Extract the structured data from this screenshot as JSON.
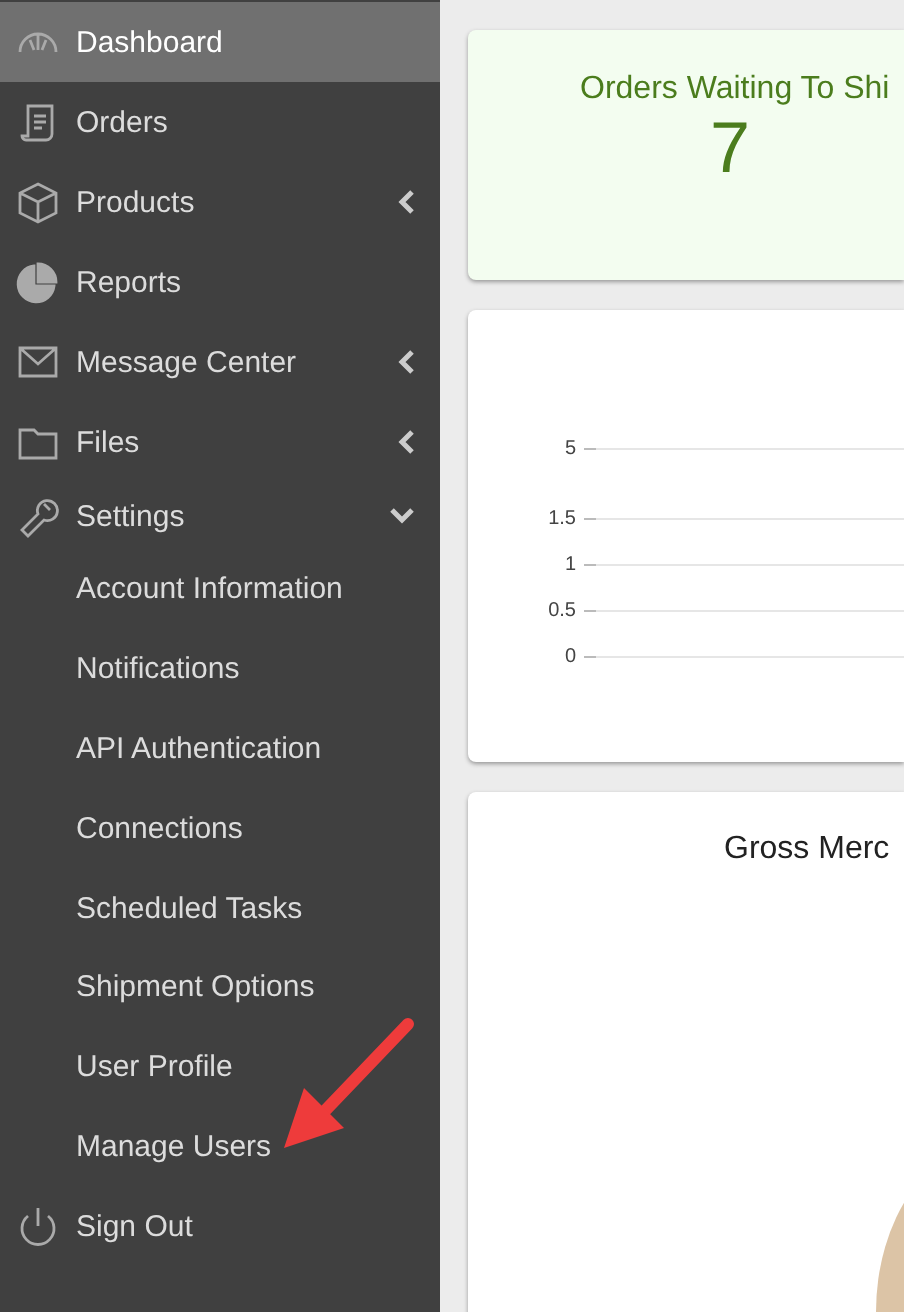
{
  "sidebar": {
    "items": [
      {
        "label": "Dashboard",
        "selected": true
      },
      {
        "label": "Orders",
        "selected": false
      },
      {
        "label": "Products",
        "selected": false,
        "expanded": false
      },
      {
        "label": "Reports",
        "selected": false
      },
      {
        "label": "Message Center",
        "selected": false,
        "expanded": false
      },
      {
        "label": "Files",
        "selected": false,
        "expanded": false
      },
      {
        "label": "Settings",
        "selected": false,
        "expanded": true,
        "children": [
          {
            "label": "Account Information",
            "selected": false
          },
          {
            "label": "Notifications",
            "selected": false
          },
          {
            "label": "API Authentication",
            "selected": false
          },
          {
            "label": "Connections",
            "selected": false
          },
          {
            "label": "Scheduled Tasks",
            "selected": false
          },
          {
            "label": "Shipment Options",
            "selected": false
          },
          {
            "label": "User Profile",
            "selected": false
          },
          {
            "label": "Manage Users",
            "selected": false
          }
        ]
      },
      {
        "label": "Sign Out",
        "selected": false
      }
    ]
  },
  "orders_card": {
    "title": "Orders Waiting To Shi",
    "value": "7"
  },
  "chart_card": {
    "y_ticks": [
      "5",
      "1.5",
      "1",
      "0.5",
      "0"
    ]
  },
  "gross_card": {
    "title": "Gross Merc"
  }
}
